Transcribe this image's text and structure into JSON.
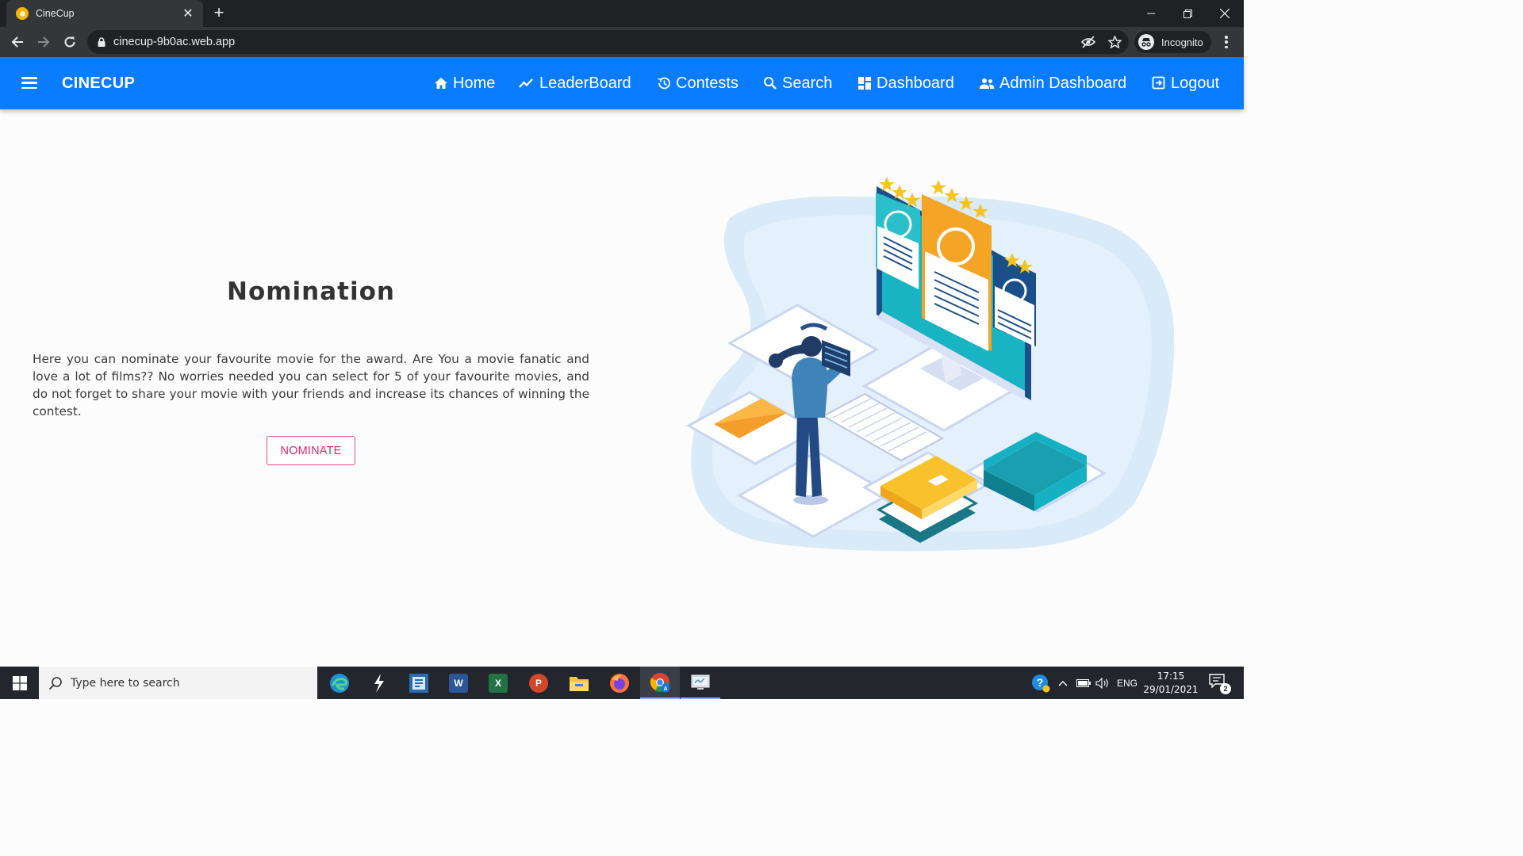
{
  "browser": {
    "tab_title": "CineCup",
    "tab_close": "✕",
    "new_tab": "+",
    "url": "cinecup-9b0ac.web.app",
    "profile_label": "Incognito"
  },
  "app": {
    "brand": "CINECUP",
    "nav": [
      {
        "label": "Home",
        "icon": "home-icon"
      },
      {
        "label": "LeaderBoard",
        "icon": "trending-icon"
      },
      {
        "label": "Contests",
        "icon": "history-icon"
      },
      {
        "label": "Search",
        "icon": "search-icon"
      },
      {
        "label": "Dashboard",
        "icon": "dashboard-icon"
      },
      {
        "label": "Admin Dashboard",
        "icon": "people-icon"
      },
      {
        "label": "Logout",
        "icon": "logout-icon"
      }
    ],
    "accent_color": "#0a7cff"
  },
  "main": {
    "title": "Nomination",
    "description": "Here you can nominate your favourite movie for the award. Are You a movie fanatic and love a lot of films?? No worries needed you can select for 5 of your favourite movies, and do not forget to share your movie with your friends and increase its chances of winning the contest.",
    "nominate_button": "NOMINATE",
    "button_color": "#e0246f"
  },
  "taskbar": {
    "search_placeholder": "Type here to search",
    "apps": [
      "edge-icon",
      "sourcetree-icon",
      "vs-icon",
      "word-icon",
      "excel-icon",
      "powerpoint-icon",
      "file-explorer-icon",
      "firefox-icon",
      "chrome-icon",
      "remote-desktop-icon"
    ],
    "language": "ENG",
    "time": "17:15",
    "date": "29/01/2021",
    "notification_count": "2"
  }
}
